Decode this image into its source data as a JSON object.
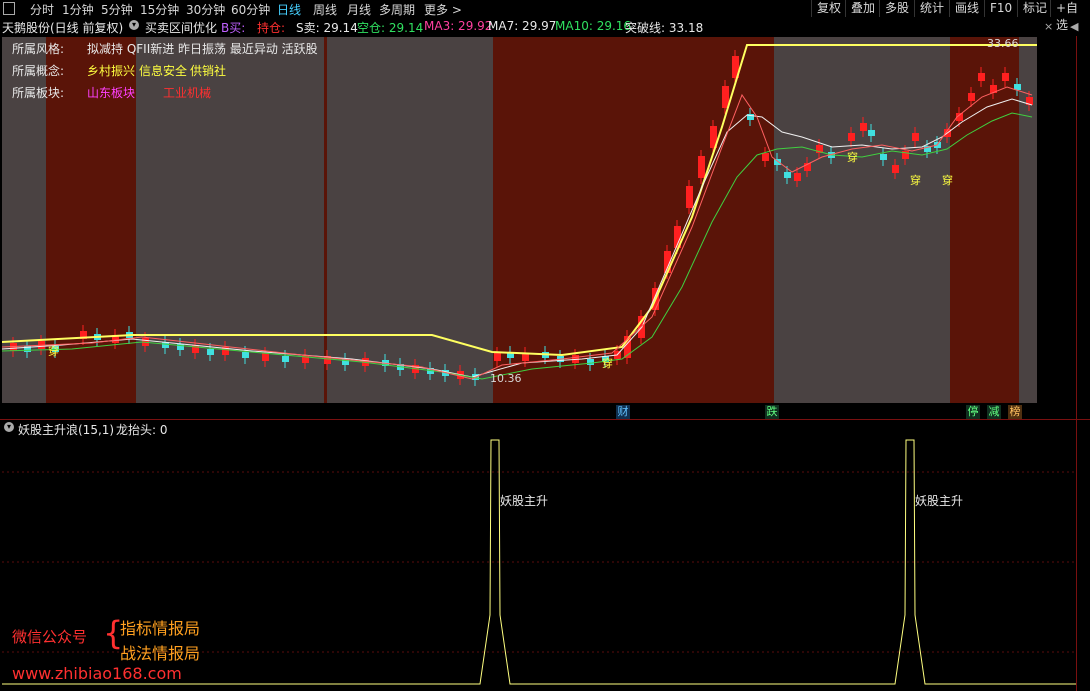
{
  "toolbar": {
    "periods": [
      "分时",
      "1分钟",
      "5分钟",
      "15分钟",
      "30分钟",
      "60分钟",
      "日线",
      "周线",
      "月线",
      "多周期",
      "更多 >"
    ],
    "active": "日线",
    "right": [
      "复权",
      "叠加",
      "多股",
      "统计",
      "画线",
      "F10",
      "标记",
      "+自选"
    ]
  },
  "infobar": {
    "stock": "天鹅股份(日线 前复权)",
    "indicator_name": "买卖区间优化",
    "b_buy": "B买:",
    "hold": "持仓:",
    "s_sell": "S卖: 29.14",
    "empty": "空仓: 29.14",
    "ma3": "MA3: 29.92",
    "ma7": "MA7: 29.97",
    "ma10": "MA10: 29.16",
    "breakout": "突破线: 33.18"
  },
  "tags": {
    "style_label": "所属风格:",
    "style_value": "拟减持 QFII新进 昨日振荡 最近异动 活跃股",
    "concept_label": "所属概念:",
    "concept_values": [
      "乡村振兴",
      "信息安全",
      "供销社"
    ],
    "sector_label": "所属板块:",
    "sector_values": [
      "山东板块",
      "工业机械"
    ]
  },
  "main_chart": {
    "high_label": "33.66",
    "low_label": "10.36",
    "chuan": "穿",
    "markers": [
      "财",
      "跌",
      "停",
      "减",
      "榜"
    ],
    "colors": {
      "up": "#ff2020",
      "down": "#40e0e0",
      "ma_yellow": "#ffff60",
      "ma_white": "#f0f0f0",
      "ma_green": "#40d040",
      "band_red": "#5a1408",
      "band_gray": "#4a4242"
    }
  },
  "sub_chart": {
    "title": "妖股主升浪(15,1)",
    "value": "龙抬头: 0",
    "signal_label": "妖股主升"
  },
  "watermark": {
    "wechat": "微信公众号",
    "brace": "{",
    "line1": "指标情报局",
    "line2": "战法情报局",
    "url": "www.zhibiao168.com"
  }
}
